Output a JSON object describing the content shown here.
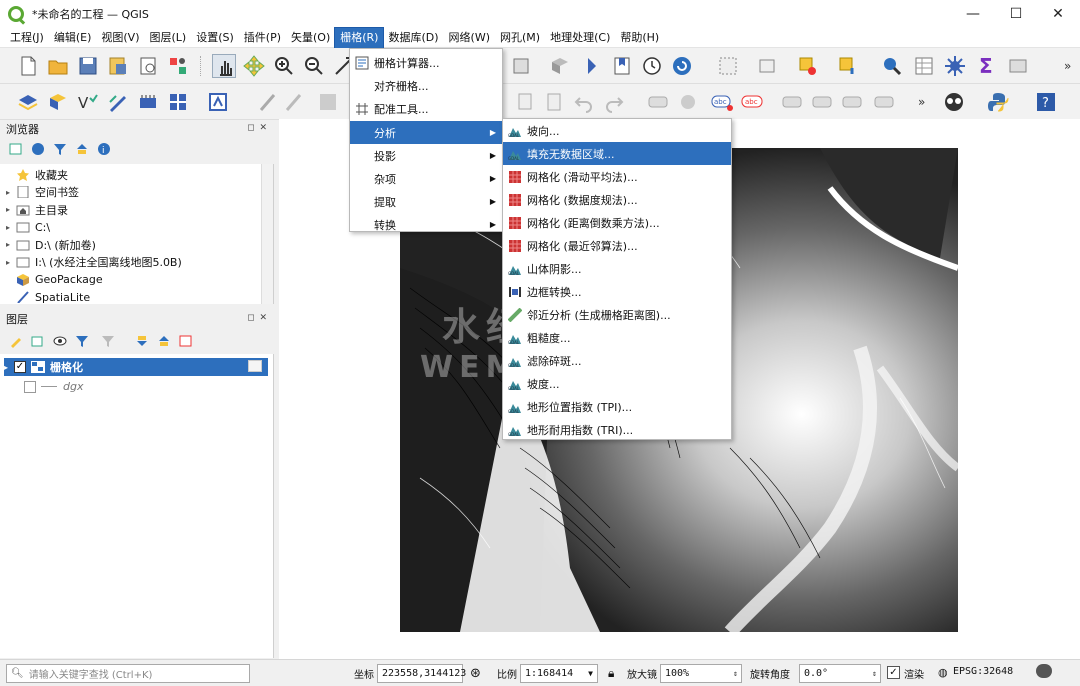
{
  "window": {
    "title": "*未命名的工程 — QGIS",
    "min": "—",
    "max": "☐",
    "close": "✕"
  },
  "menubar": [
    "工程(J)",
    "编辑(E)",
    "视图(V)",
    "图层(L)",
    "设置(S)",
    "插件(P)",
    "矢量(O)",
    "栅格(R)",
    "数据库(D)",
    "网络(W)",
    "网孔(M)",
    "地理处理(C)",
    "帮助(H)"
  ],
  "menubar_active": "栅格(R)",
  "browser": {
    "title": "浏览器",
    "items": [
      {
        "label": "收藏夹",
        "icon": "star-icon"
      },
      {
        "label": "空间书签",
        "icon": "bookmark-icon"
      },
      {
        "label": "主目录",
        "icon": "home-folder-icon"
      },
      {
        "label": "C:\\",
        "icon": "folder-icon"
      },
      {
        "label": "D:\\ (新加卷)",
        "icon": "folder-icon"
      },
      {
        "label": "I:\\ (水经注全国离线地图5.0B)",
        "icon": "folder-icon"
      },
      {
        "label": "GeoPackage",
        "icon": "geopackage-icon"
      },
      {
        "label": "SpatiaLite",
        "icon": "spatialite-icon"
      }
    ]
  },
  "layers": {
    "title": "图层",
    "items": [
      {
        "label": "栅格化",
        "checked": true,
        "selected": true
      },
      {
        "label": "dgx",
        "checked": false,
        "selected": false
      }
    ]
  },
  "raster_menu": [
    "栅格计算器...",
    "对齐栅格...",
    "配准工具...",
    "分析",
    "投影",
    "杂项",
    "提取",
    "转换"
  ],
  "analysis_menu": [
    "坡向...",
    "填充无数据区域...",
    "网格化 (滑动平均法)...",
    "网格化 (数据度规法)...",
    "网格化 (距离倒数乘方法)...",
    "网格化 (最近邻算法)...",
    "山体阴影...",
    "边框转换...",
    "邻近分析 (生成栅格距离图)...",
    "粗糙度...",
    "滤除碎斑...",
    "坡度...",
    "地形位置指数 (TPI)...",
    "地形耐用指数 (TRI)..."
  ],
  "watermark": {
    "line1": "水经微图",
    "line2": "WEMAPGIS"
  },
  "statusbar": {
    "search_placeholder": "请输入关键字查找 (Ctrl+K)",
    "coord_label": "坐标",
    "coord_value": "223558,3144123",
    "scale_label": "比例",
    "scale_value": "1:168414",
    "magnifier_label": "放大镜",
    "magnifier_value": "100%",
    "rotation_label": "旋转角度",
    "rotation_value": "0.0°",
    "render_label": "渲染",
    "crs": "EPSG:32648"
  },
  "colors": {
    "accent": "#2d6fbd",
    "qgis_green": "#5aa833"
  }
}
